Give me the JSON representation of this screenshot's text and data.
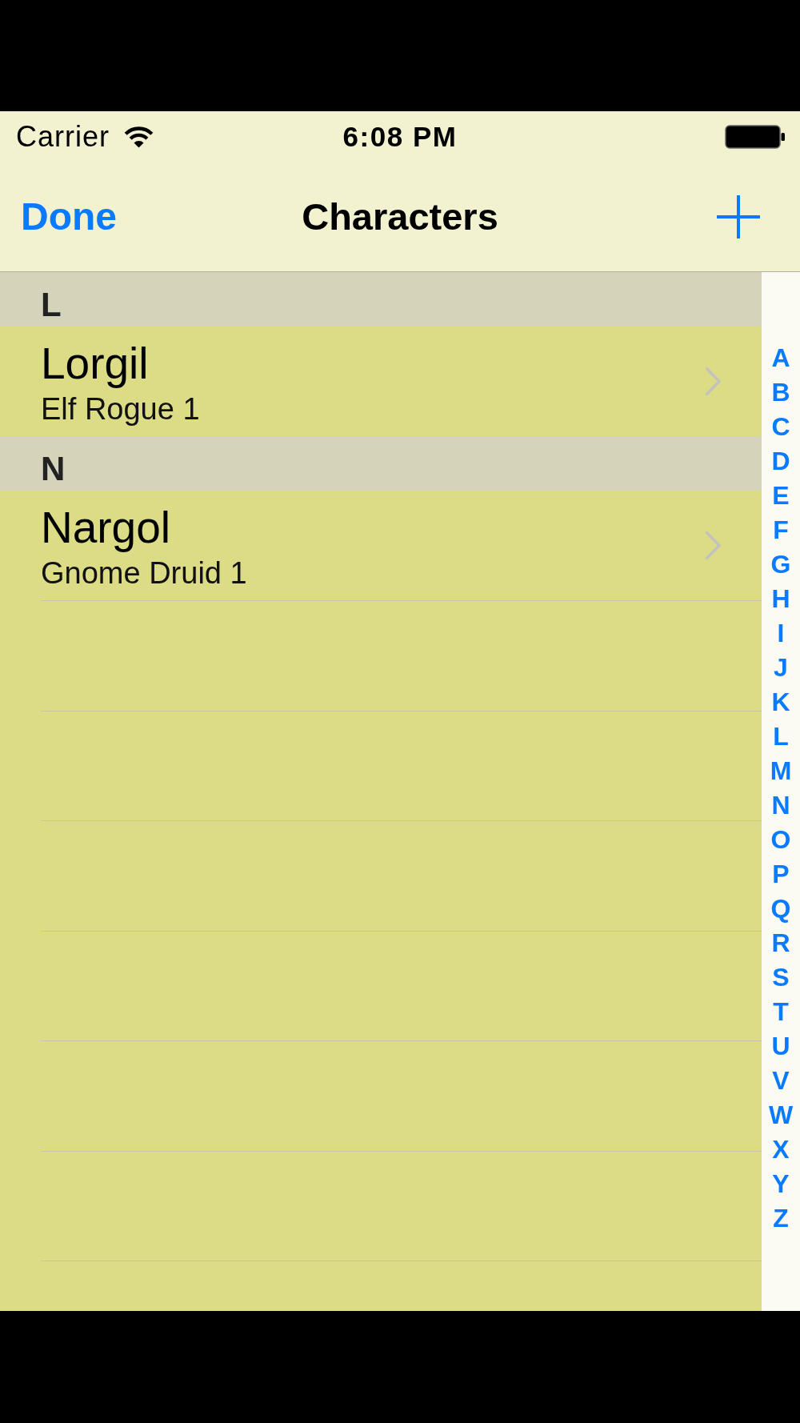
{
  "status_bar": {
    "carrier": "Carrier",
    "time": "6:08 PM"
  },
  "nav_bar": {
    "left_button": "Done",
    "title": "Characters"
  },
  "sections": [
    {
      "header": "L",
      "rows": [
        {
          "name": "Lorgil",
          "detail": "Elf Rogue 1"
        }
      ]
    },
    {
      "header": "N",
      "rows": [
        {
          "name": "Nargol",
          "detail": "Gnome Druid 1"
        }
      ]
    }
  ],
  "section_index": [
    "A",
    "B",
    "C",
    "D",
    "E",
    "F",
    "G",
    "H",
    "I",
    "J",
    "K",
    "L",
    "M",
    "N",
    "O",
    "P",
    "Q",
    "R",
    "S",
    "T",
    "U",
    "V",
    "W",
    "X",
    "Y",
    "Z"
  ]
}
